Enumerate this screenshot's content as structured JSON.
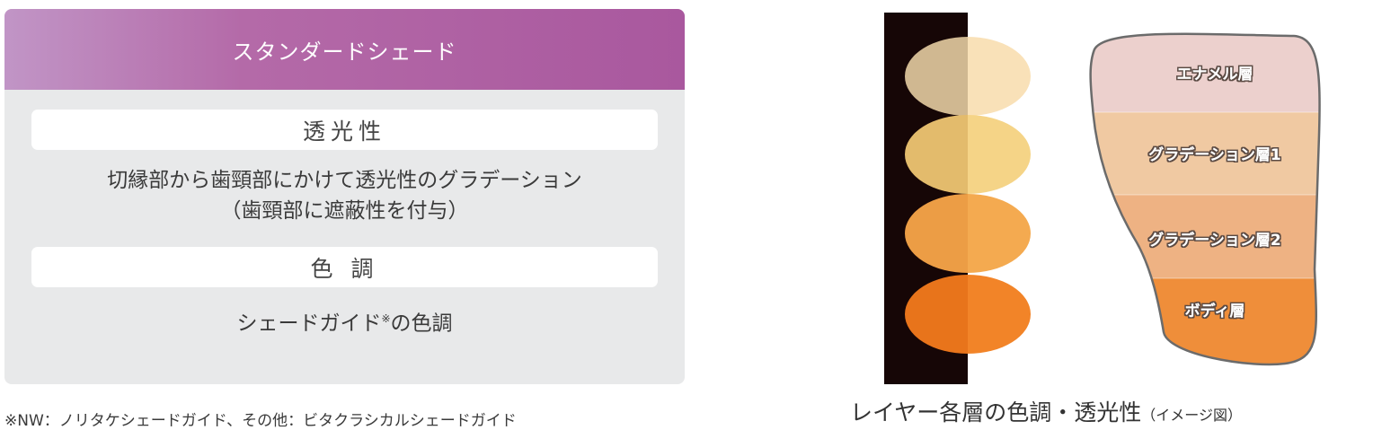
{
  "card": {
    "header": "スタンダードシェード",
    "translucency": {
      "label": "透光性",
      "description_line1": "切縁部から歯頸部にかけて透光性のグラデーション",
      "description_line2": "（歯頸部に遮蔽性を付与）"
    },
    "shade": {
      "label": "色 調",
      "description_main": "シェードガイド",
      "description_mark": "※",
      "description_tail": "の色調"
    }
  },
  "footnote": "※NW：ノリタケシェードガイド、その他：ビタクラシカルシェードガイド",
  "diagram": {
    "layers": [
      {
        "label": "エナメル層",
        "color": "#ecd0cd"
      },
      {
        "label": "グラデーション層1",
        "color": "#f0c9a2"
      },
      {
        "label": "グラデーション層2",
        "color": "#eeb283"
      },
      {
        "label": "ボディ層",
        "color": "#ef8e3a"
      }
    ],
    "swatches": [
      {
        "dark": "#d0b891",
        "light": "#f9e1b8"
      },
      {
        "dark": "#e3bb6c",
        "light": "#f5d487"
      },
      {
        "dark": "#ec9d45",
        "light": "#f4aa50"
      },
      {
        "dark": "#e8741b",
        "light": "#f28428"
      }
    ],
    "background_color": "#160606",
    "caption_main": "レイヤー各層の色調・透光性",
    "caption_note": "（イメージ図）"
  }
}
